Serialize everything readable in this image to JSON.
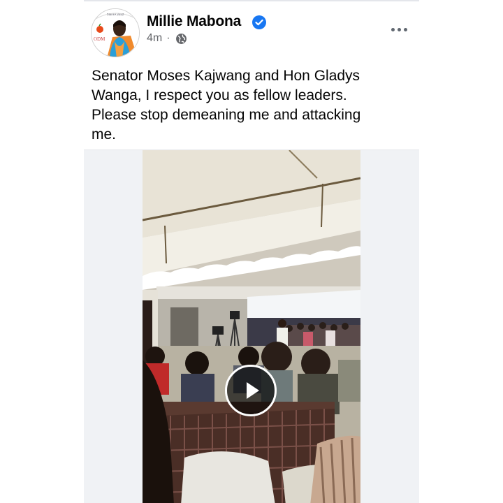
{
  "post": {
    "author_name": "Millie Mabona",
    "verified": true,
    "time": "4m",
    "separator": "·",
    "audience_icon": "globe-icon",
    "more_icon": "more-options-icon",
    "text": "Senator Moses Kajwang and Hon Gladys\nWanga, I respect you as fellow leaders.\nPlease stop demeaning me and attacking\nme.",
    "avatar": {
      "logo_text": "ODM",
      "top_text": "MBITA 2022"
    }
  },
  "media": {
    "type": "video",
    "play_icon": "play-icon"
  },
  "colors": {
    "verified": "#1877f2",
    "meta_text": "#65676b",
    "name_text": "#050505"
  }
}
